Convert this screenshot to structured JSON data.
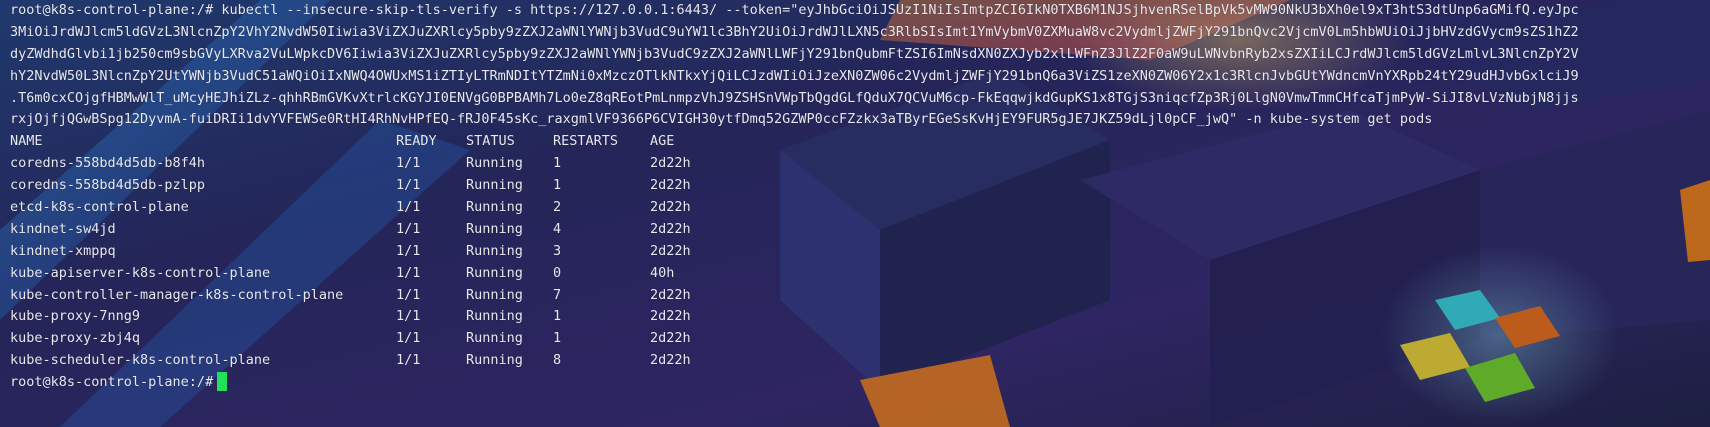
{
  "terminal": {
    "prompt": "root@k8s-control-plane:/#",
    "command_lines": [
      "root@k8s-control-plane:/# kubectl --insecure-skip-tls-verify -s https://127.0.0.1:6443/ --token=\"eyJhbGciOiJSUzI1NiIsImtpZCI6IkN0TXB6M1NJSjhvenRSelBpVk5vMW90NkU3bXh0el9xT3htS3dtUnp6aGMifQ.eyJpc",
      "3MiOiJrdWJlcm5ldGVzL3NlcnZpY2VhY2NvdW50Iiwia3ViZXJuZXRlcy5pby9zZXJ2aWNlYWNjb3VudC9uYW1lc3BhY2UiOiJrdWJlLXN5c3RlbSIsImt1YmVybmV0ZXMuaW8vc2VydmljZWFjY291bnQvc2VjcmV0Lm5hbWUiOiJjbHVzdGVycm9sZS1hZ2",
      "dyZWdhdGlvbi1jb250cm9sbGVyLXRva2VuLWpkcDV6Iiwia3ViZXJuZXRlcy5pby9zZXJ2aWNlYWNjb3VudC9zZXJ2aWNlLWFjY291bnQubmFtZSI6ImNsdXN0ZXJyb2xlLWFnZ3JlZ2F0aW9uLWNvbnRyb2xsZXIiLCJrdWJlcm5ldGVzLmlvL3NlcnZpY2V",
      "hY2NvdW50L3NlcnZpY2UtYWNjb3VudC51aWQiOiIxNWQ4OWUxMS1iZTIyLTRmNDItYTZmNi0xMzczOTlkNTkxYjQiLCJzdWIiOiJzeXN0ZW06c2VydmljZWFjY291bnQ6a3ViZS1zeXN0ZW06Y2x1c3RlcnJvbGUtYWdncmVnYXRpb24tY29udHJvbGxlciJ9",
      ".T6m0cxCOjgfHBMwWlT_uMcyHEJhiZLz-qhhRBmGVKvXtrlcKGYJI0ENVgG0BPBAMh7Lo0eZ8qREotPmLnmpzVhJ9ZSHSnVWpTbQgdGLfQduX7QCVuM6cp-FkEqqwjkdGupKS1x8TGjS3niqcfZp3Rj0LlgN0VmwTmmCHfcaTjmPyW-SiJI8vLVzNubjN8jjs",
      "rxjOjfjQGwBSpg12DyvmA-fuiDRIi1dvYVFEWSe0RtHI4RhNvHPfEQ-fRJ0F45sKc_raxgmlVF9366P6CVIGH30ytfDmq52GZWP0ccFZzkx3aTByrEGeSsKvHjEY9FUR5gJE7JKZ59dLjl0pCF_jwQ\" -n kube-system get pods"
    ],
    "table": {
      "headers": [
        "NAME",
        "READY",
        "STATUS",
        "RESTARTS",
        "AGE"
      ],
      "rows": [
        {
          "name": "coredns-558bd4d5db-b8f4h",
          "ready": "1/1",
          "status": "Running",
          "restarts": "1",
          "age": "2d22h"
        },
        {
          "name": "coredns-558bd4d5db-pzlpp",
          "ready": "1/1",
          "status": "Running",
          "restarts": "1",
          "age": "2d22h"
        },
        {
          "name": "etcd-k8s-control-plane",
          "ready": "1/1",
          "status": "Running",
          "restarts": "2",
          "age": "2d22h"
        },
        {
          "name": "kindnet-sw4jd",
          "ready": "1/1",
          "status": "Running",
          "restarts": "4",
          "age": "2d22h"
        },
        {
          "name": "kindnet-xmppq",
          "ready": "1/1",
          "status": "Running",
          "restarts": "3",
          "age": "2d22h"
        },
        {
          "name": "kube-apiserver-k8s-control-plane",
          "ready": "1/1",
          "status": "Running",
          "restarts": "0",
          "age": "40h"
        },
        {
          "name": "kube-controller-manager-k8s-control-plane",
          "ready": "1/1",
          "status": "Running",
          "restarts": "7",
          "age": "2d22h"
        },
        {
          "name": "kube-proxy-7nng9",
          "ready": "1/1",
          "status": "Running",
          "restarts": "1",
          "age": "2d22h"
        },
        {
          "name": "kube-proxy-zbj4q",
          "ready": "1/1",
          "status": "Running",
          "restarts": "1",
          "age": "2d22h"
        },
        {
          "name": "kube-scheduler-k8s-control-plane",
          "ready": "1/1",
          "status": "Running",
          "restarts": "8",
          "age": "2d22h"
        }
      ]
    },
    "final_prompt": "root@k8s-control-plane:/#"
  },
  "colors": {
    "text": "#e8e8ee",
    "cursor": "#23e05a",
    "background": "#1b1f3a",
    "logo_cyan": "#3fe6f0",
    "logo_orange": "#ff7a1a",
    "logo_yellow": "#ffe63a",
    "logo_green": "#7ee62c"
  },
  "icons": {
    "wallpaper_logo": "windows-logo-icon"
  }
}
